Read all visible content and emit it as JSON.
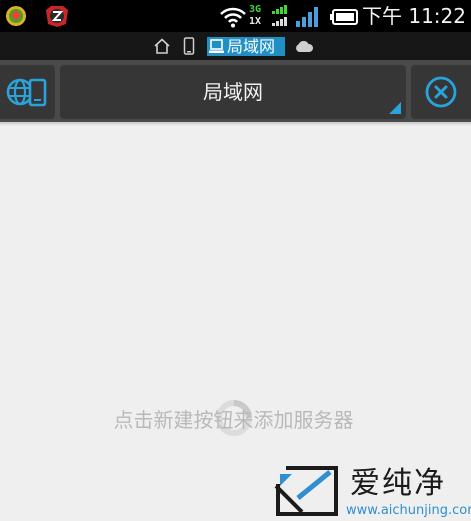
{
  "status_bar": {
    "network_type_top": "3G",
    "network_type_bottom": "1X",
    "time": "下午 11:22",
    "icons": [
      "app-notification-icon",
      "app-notification-icon",
      "wifi-icon",
      "data-activity-icon",
      "signal-icon",
      "battery-icon"
    ]
  },
  "tab_strip": {
    "tabs": [
      {
        "icon": "home-icon"
      },
      {
        "icon": "phone-icon"
      },
      {
        "icon": "computer-icon",
        "label": "局域网",
        "active": true
      },
      {
        "icon": "cloud-icon"
      }
    ],
    "active_color": "#1f8fc4"
  },
  "header": {
    "title": "局域网",
    "left_icon": "network-device-icon",
    "right_icon": "close-circle-icon",
    "accent_color": "#29a3dc"
  },
  "main": {
    "empty_hint": "点击新建按钮来添加服务器"
  },
  "watermark": {
    "brand": "爱纯净",
    "url": "www.aichunjing.com"
  }
}
